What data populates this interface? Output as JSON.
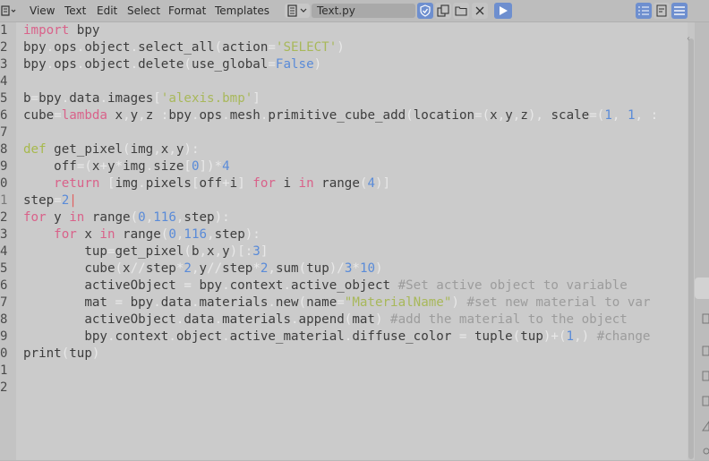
{
  "header": {
    "menus": [
      "View",
      "Text",
      "Edit",
      "Select",
      "Format",
      "Templates"
    ],
    "filename": "Text.py"
  },
  "editor": {
    "line_numbers": [
      "1",
      "2",
      "3",
      "4",
      "5",
      "6",
      "7",
      "8",
      "9",
      "0",
      "1",
      "2",
      "3",
      "4",
      "5",
      "6",
      "7",
      "8",
      "9",
      "0",
      "1",
      "2"
    ],
    "current_line_index": 10,
    "lines": [
      [
        [
          "kw",
          "import"
        ],
        [
          "n",
          " bpy"
        ]
      ],
      [
        [
          "n",
          "bpy"
        ],
        [
          "op",
          "."
        ],
        [
          "n",
          "ops"
        ],
        [
          "op",
          "."
        ],
        [
          "n",
          "object"
        ],
        [
          "op",
          "."
        ],
        [
          "n",
          "select_all"
        ],
        [
          "op",
          "("
        ],
        [
          "n",
          "action"
        ],
        [
          "op",
          "="
        ],
        [
          "str",
          "'SELECT'"
        ],
        [
          "op",
          ")"
        ]
      ],
      [
        [
          "n",
          "bpy"
        ],
        [
          "op",
          "."
        ],
        [
          "n",
          "ops"
        ],
        [
          "op",
          "."
        ],
        [
          "n",
          "object"
        ],
        [
          "op",
          "."
        ],
        [
          "n",
          "delete"
        ],
        [
          "op",
          "("
        ],
        [
          "n",
          "use_global"
        ],
        [
          "op",
          "="
        ],
        [
          "num",
          "False"
        ],
        [
          "op",
          ")"
        ]
      ],
      [],
      [
        [
          "n",
          "b"
        ],
        [
          "op",
          "="
        ],
        [
          "n",
          "bpy"
        ],
        [
          "op",
          "."
        ],
        [
          "n",
          "data"
        ],
        [
          "op",
          "."
        ],
        [
          "n",
          "images"
        ],
        [
          "op",
          "["
        ],
        [
          "str",
          "'alexis.bmp'"
        ],
        [
          "op",
          "]"
        ]
      ],
      [
        [
          "n",
          "cube"
        ],
        [
          "op",
          "="
        ],
        [
          "kw",
          "lambda"
        ],
        [
          "n",
          " x"
        ],
        [
          "op",
          ","
        ],
        [
          "n",
          "y"
        ],
        [
          "op",
          ","
        ],
        [
          "n",
          "z "
        ],
        [
          "op",
          ":"
        ],
        [
          "n",
          "bpy"
        ],
        [
          "op",
          "."
        ],
        [
          "n",
          "ops"
        ],
        [
          "op",
          "."
        ],
        [
          "n",
          "mesh"
        ],
        [
          "op",
          "."
        ],
        [
          "n",
          "primitive_cube_add"
        ],
        [
          "op",
          "("
        ],
        [
          "n",
          "location"
        ],
        [
          "op",
          "=("
        ],
        [
          "n",
          "x"
        ],
        [
          "op",
          ","
        ],
        [
          "n",
          "y"
        ],
        [
          "op",
          ","
        ],
        [
          "n",
          "z"
        ],
        [
          "op",
          "),"
        ],
        [
          "n",
          " scale"
        ],
        [
          "op",
          "=("
        ],
        [
          "num",
          "1"
        ],
        [
          "op",
          ", "
        ],
        [
          "num",
          "1"
        ],
        [
          "op",
          ", "
        ],
        [
          "op",
          ":"
        ]
      ],
      [],
      [
        [
          "def",
          "def"
        ],
        [
          "n",
          " get_pixel"
        ],
        [
          "op",
          "("
        ],
        [
          "n",
          "img"
        ],
        [
          "op",
          ","
        ],
        [
          "n",
          "x"
        ],
        [
          "op",
          ","
        ],
        [
          "n",
          "y"
        ],
        [
          "op",
          "):"
        ]
      ],
      [
        [
          "n",
          "    off"
        ],
        [
          "op",
          "=("
        ],
        [
          "n",
          "x"
        ],
        [
          "op",
          "+"
        ],
        [
          "n",
          "y"
        ],
        [
          "op",
          "*"
        ],
        [
          "n",
          "img"
        ],
        [
          "op",
          "."
        ],
        [
          "n",
          "size"
        ],
        [
          "op",
          "["
        ],
        [
          "num",
          "0"
        ],
        [
          "op",
          "])*"
        ],
        [
          "num",
          "4"
        ]
      ],
      [
        [
          "n",
          "    "
        ],
        [
          "kw",
          "return"
        ],
        [
          "op",
          " ["
        ],
        [
          "n",
          "img"
        ],
        [
          "op",
          "."
        ],
        [
          "n",
          "pixels"
        ],
        [
          "op",
          "["
        ],
        [
          "n",
          "off"
        ],
        [
          "op",
          "+"
        ],
        [
          "n",
          "i"
        ],
        [
          "op",
          "] "
        ],
        [
          "kw",
          "for"
        ],
        [
          "n",
          " i "
        ],
        [
          "kw",
          "in"
        ],
        [
          "n",
          " range"
        ],
        [
          "op",
          "("
        ],
        [
          "num",
          "4"
        ],
        [
          "op",
          ")]"
        ]
      ],
      [
        [
          "n",
          "step"
        ],
        [
          "op",
          "="
        ],
        [
          "num",
          "2"
        ],
        [
          "cur",
          "|"
        ]
      ],
      [
        [
          "kw",
          "for"
        ],
        [
          "n",
          " y "
        ],
        [
          "kw",
          "in"
        ],
        [
          "n",
          " range"
        ],
        [
          "op",
          "("
        ],
        [
          "num",
          "0"
        ],
        [
          "op",
          ","
        ],
        [
          "num",
          "116"
        ],
        [
          "op",
          ","
        ],
        [
          "n",
          "step"
        ],
        [
          "op",
          "):"
        ]
      ],
      [
        [
          "n",
          "    "
        ],
        [
          "kw",
          "for"
        ],
        [
          "n",
          " x "
        ],
        [
          "kw",
          "in"
        ],
        [
          "n",
          " range"
        ],
        [
          "op",
          "("
        ],
        [
          "num",
          "0"
        ],
        [
          "op",
          ","
        ],
        [
          "num",
          "116"
        ],
        [
          "op",
          ","
        ],
        [
          "n",
          "step"
        ],
        [
          "op",
          "):"
        ]
      ],
      [
        [
          "n",
          "        tup"
        ],
        [
          "op",
          "="
        ],
        [
          "n",
          "get_pixel"
        ],
        [
          "op",
          "("
        ],
        [
          "n",
          "b"
        ],
        [
          "op",
          ","
        ],
        [
          "n",
          "x"
        ],
        [
          "op",
          ","
        ],
        [
          "n",
          "y"
        ],
        [
          "op",
          ")[:"
        ],
        [
          "num",
          "3"
        ],
        [
          "op",
          "]"
        ]
      ],
      [
        [
          "n",
          "        cube"
        ],
        [
          "op",
          "("
        ],
        [
          "n",
          "x"
        ],
        [
          "op",
          "//"
        ],
        [
          "n",
          "step"
        ],
        [
          "op",
          "*"
        ],
        [
          "num",
          "2"
        ],
        [
          "op",
          ","
        ],
        [
          "n",
          "y"
        ],
        [
          "op",
          "//"
        ],
        [
          "n",
          "step"
        ],
        [
          "op",
          "*"
        ],
        [
          "num",
          "2"
        ],
        [
          "op",
          ","
        ],
        [
          "n",
          "sum"
        ],
        [
          "op",
          "("
        ],
        [
          "n",
          "tup"
        ],
        [
          "op",
          ")/"
        ],
        [
          "num",
          "3"
        ],
        [
          "op",
          "*"
        ],
        [
          "num",
          "10"
        ],
        [
          "op",
          ")"
        ]
      ],
      [
        [
          "n",
          "        activeObject "
        ],
        [
          "op",
          "="
        ],
        [
          "n",
          " bpy"
        ],
        [
          "op",
          "."
        ],
        [
          "n",
          "context"
        ],
        [
          "op",
          "."
        ],
        [
          "n",
          "active_object "
        ],
        [
          "cm",
          "#Set active object to variable"
        ]
      ],
      [
        [
          "n",
          "        mat "
        ],
        [
          "op",
          "="
        ],
        [
          "n",
          " bpy"
        ],
        [
          "op",
          "."
        ],
        [
          "n",
          "data"
        ],
        [
          "op",
          "."
        ],
        [
          "n",
          "materials"
        ],
        [
          "op",
          "."
        ],
        [
          "n",
          "new"
        ],
        [
          "op",
          "("
        ],
        [
          "n",
          "name"
        ],
        [
          "op",
          "="
        ],
        [
          "str",
          "\"MaterialName\""
        ],
        [
          "op",
          ") "
        ],
        [
          "cm",
          "#set new material to var"
        ]
      ],
      [
        [
          "n",
          "        activeObject"
        ],
        [
          "op",
          "."
        ],
        [
          "n",
          "data"
        ],
        [
          "op",
          "."
        ],
        [
          "n",
          "materials"
        ],
        [
          "op",
          "."
        ],
        [
          "n",
          "append"
        ],
        [
          "op",
          "("
        ],
        [
          "n",
          "mat"
        ],
        [
          "op",
          ") "
        ],
        [
          "cm",
          "#add the material to the object"
        ]
      ],
      [
        [
          "n",
          "        bpy"
        ],
        [
          "op",
          "."
        ],
        [
          "n",
          "context"
        ],
        [
          "op",
          "."
        ],
        [
          "n",
          "object"
        ],
        [
          "op",
          "."
        ],
        [
          "n",
          "active_material"
        ],
        [
          "op",
          "."
        ],
        [
          "n",
          "diffuse_color "
        ],
        [
          "op",
          "="
        ],
        [
          "n",
          " tuple"
        ],
        [
          "op",
          "("
        ],
        [
          "n",
          "tup"
        ],
        [
          "op",
          ")+("
        ],
        [
          "num",
          "1"
        ],
        [
          "op",
          ",) "
        ],
        [
          "cm",
          "#change"
        ]
      ],
      [
        [
          "n",
          "print"
        ],
        [
          "op",
          "("
        ],
        [
          "n",
          "tup"
        ],
        [
          "op",
          ")"
        ]
      ],
      [],
      []
    ]
  },
  "colors": {
    "kw": "#d9628a",
    "def": "#a7b94d",
    "str": "#a8b85a",
    "num": "#5a8bd8",
    "op": "#e8e8e8",
    "n": "#3d3d3d",
    "cm": "#9c9c9c",
    "cur": "#e06060"
  },
  "icons": {
    "editor_type": "text-editor-icon",
    "browse": "text-document-icon",
    "fake_user": "shield-check-icon",
    "copy": "duplicate-icon",
    "open": "folder-icon",
    "close": "close-icon",
    "run": "play-icon",
    "line_numbers": "line-numbers-icon",
    "word_wrap": "word-wrap-icon",
    "syntax": "syntax-highlight-icon"
  }
}
